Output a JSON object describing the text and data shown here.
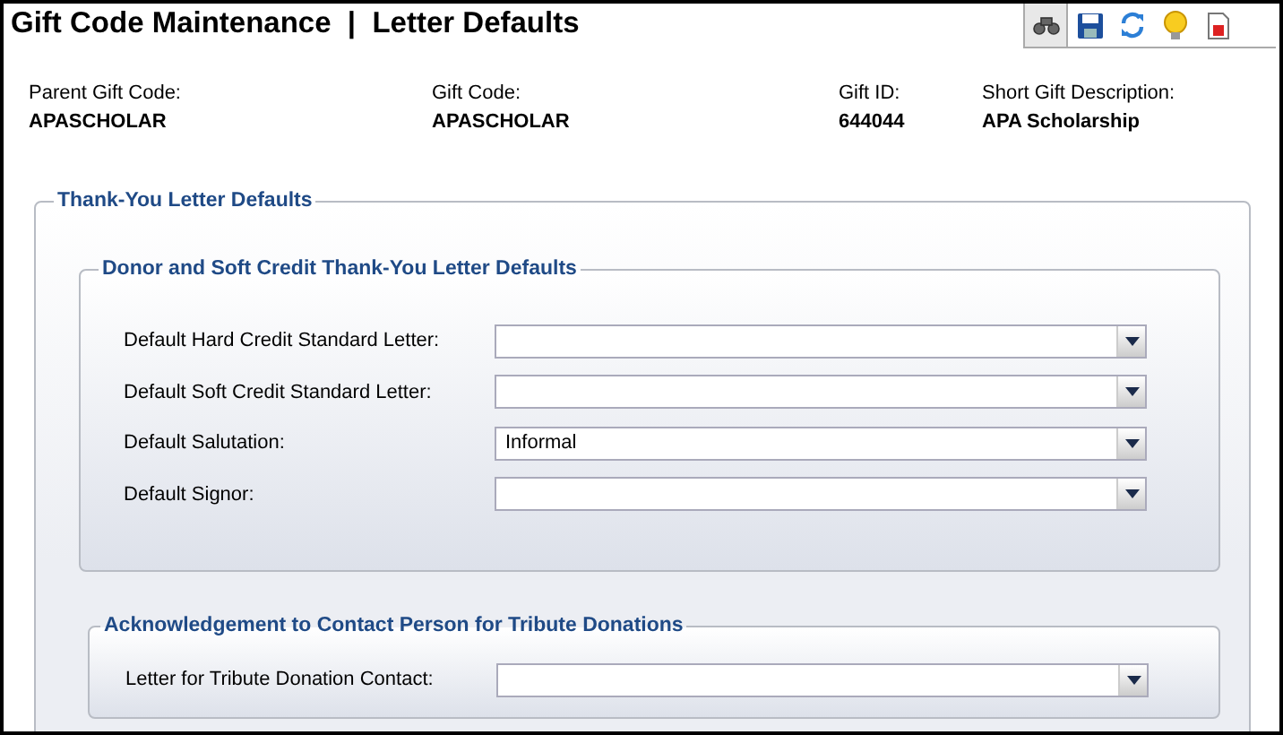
{
  "window": {
    "title": "Gift Code Maintenance  |  Letter Defaults"
  },
  "toolbar": [
    {
      "kind": "binoculars"
    },
    {
      "kind": "save"
    },
    {
      "kind": "refresh"
    },
    {
      "kind": "bulb"
    },
    {
      "kind": "report"
    }
  ],
  "header_fields": [
    {
      "label": "Parent Gift Code:",
      "value": "APASCHOLAR"
    },
    {
      "label": "Gift Code:",
      "value": "APASCHOLAR"
    },
    {
      "label": "Gift ID:",
      "value": "644044"
    },
    {
      "label": "Short Gift Description:",
      "value": "APA Scholarship"
    }
  ],
  "section": {
    "title": "Thank-You Letter Defaults",
    "groups": [
      {
        "title": "Donor and Soft Credit Thank-You Letter Defaults",
        "fields": [
          {
            "label": "Default Hard Credit Standard Letter:"
          },
          {
            "label": "Default Soft Credit Standard Letter:"
          },
          {
            "label": "Default Salutation:",
            "value": "Informal"
          },
          {
            "label": "Default Signor:"
          }
        ]
      },
      {
        "title": "Acknowledgement to Contact Person for Tribute Donations",
        "fields": [
          {
            "label": "Letter for Tribute Donation Contact:"
          }
        ]
      }
    ]
  }
}
